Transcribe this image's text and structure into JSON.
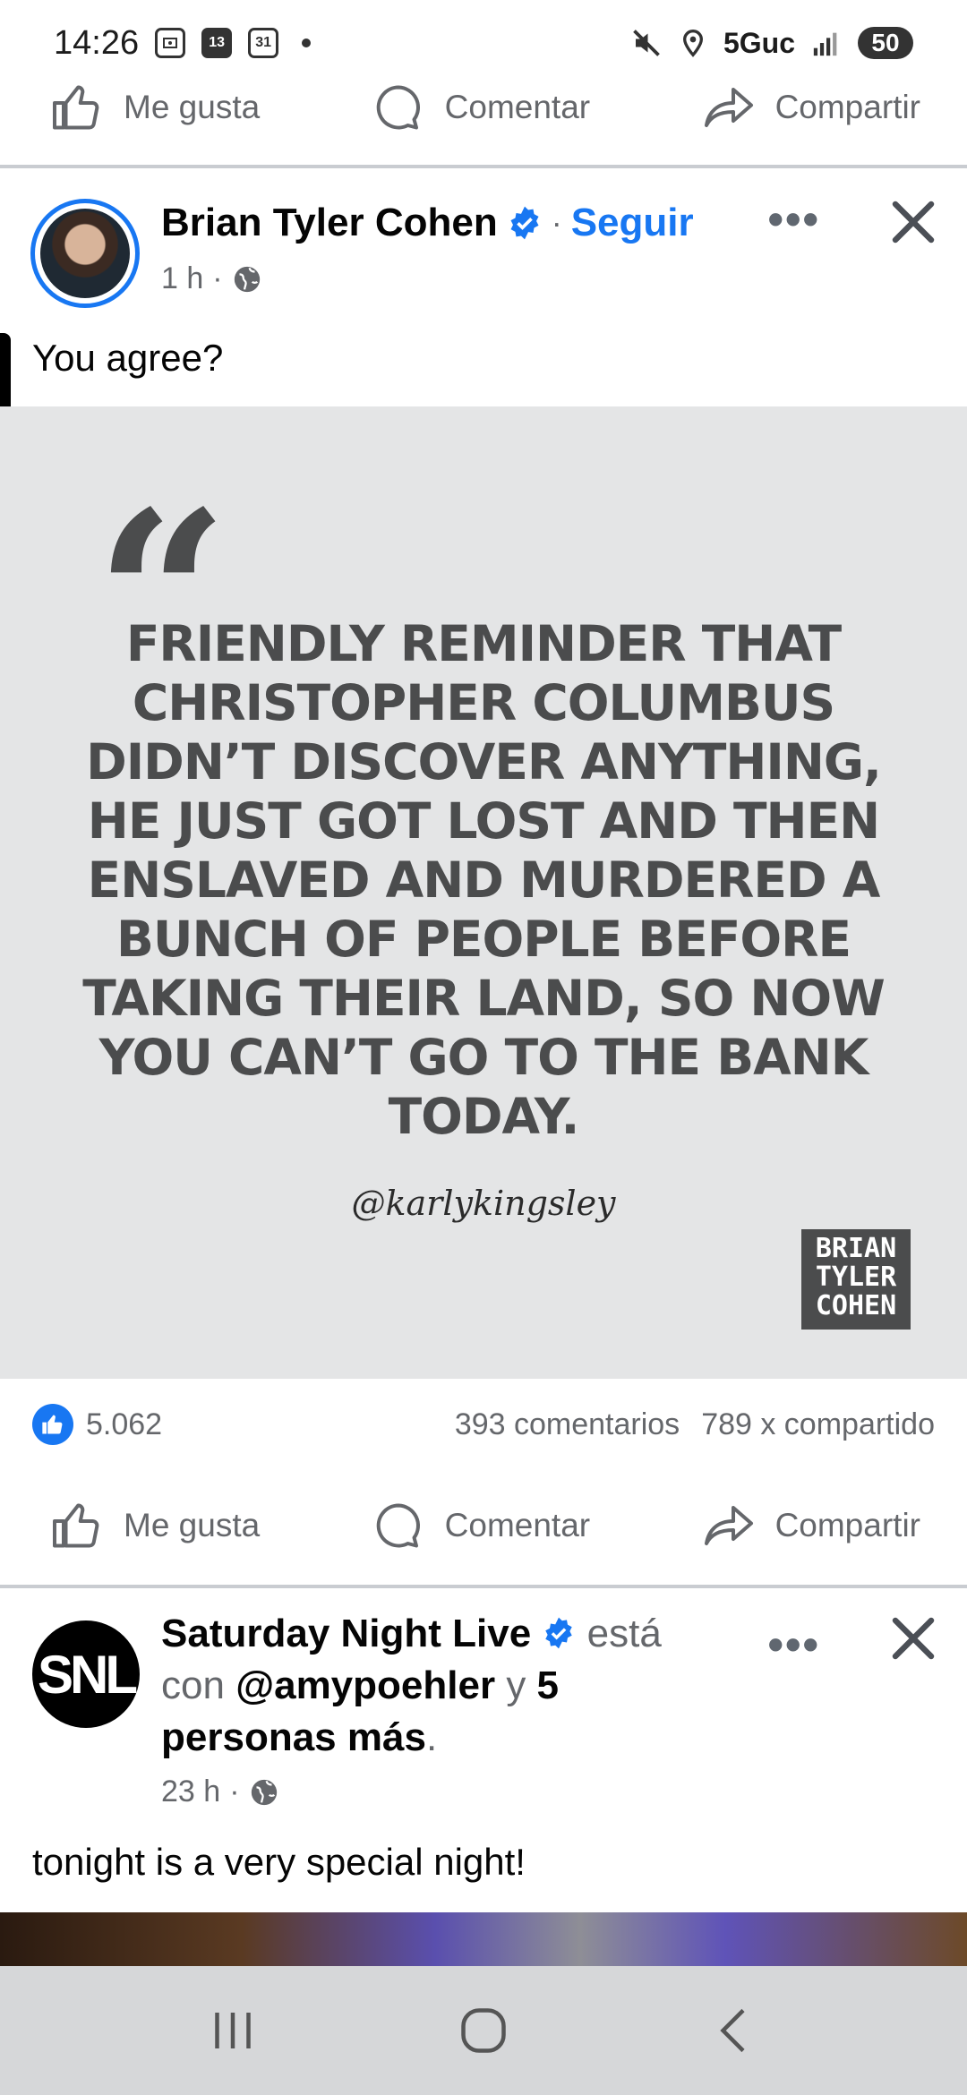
{
  "status_bar": {
    "time": "14:26",
    "icons": [
      "gallery-icon",
      "calendar-13-icon",
      "calendar-31-icon",
      "dot-icon"
    ],
    "cal1": "13",
    "cal2": "31",
    "network": "5Guc",
    "battery": "50"
  },
  "actions": {
    "like": "Me gusta",
    "comment": "Comentar",
    "share": "Compartir"
  },
  "post1": {
    "author": "Brian Tyler Cohen",
    "separator": "·",
    "follow": "Seguir",
    "time": "1 h",
    "dot": "·",
    "text": "You agree?",
    "quote": "FRIENDLY REMINDER THAT CHRISTOPHER COLUMBUS DIDN’T DISCOVER ANYTHING, HE JUST GOT LOST AND THEN ENSLAVED AND MURDERED A BUNCH OF PEOPLE BEFORE TAKING THEIR LAND, SO NOW YOU CAN’T GO TO THE BANK TODAY.",
    "handle": "@karlykingsley",
    "logo_line1": "BRIAN",
    "logo_line2": "TYLER",
    "logo_line3": "COHEN",
    "likes": "5.062",
    "comments": "393 comentarios",
    "shares": "789 x compartido"
  },
  "post2": {
    "author": "Saturday Night Live",
    "is_with": "está con",
    "tagged": "@amypoehler",
    "conj": "y",
    "others": "5 personas más",
    "period": ".",
    "time": "23 h",
    "dot": "·",
    "text": "tonight is a very special night!",
    "avatar_text": "SNL"
  },
  "colors": {
    "accent": "#1877f2",
    "muted": "#65676b",
    "quote_bg": "#e4e5e6",
    "quote_text": "#4b4c4d"
  }
}
